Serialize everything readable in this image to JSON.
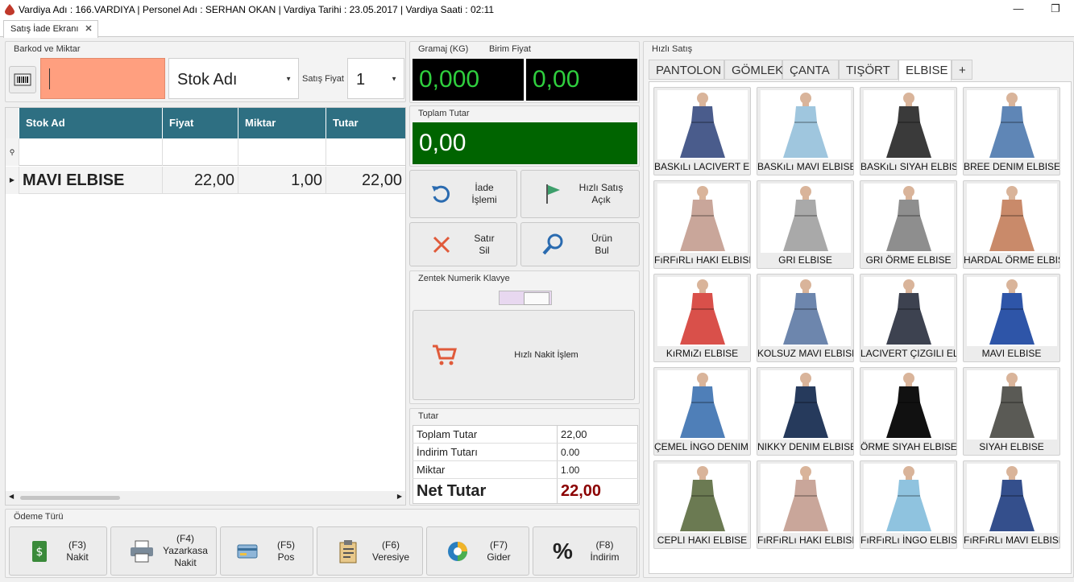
{
  "window": {
    "title": "Vardiya Adı : 166.VARDIYA | Personel Adı : SERHAN OKAN | Vardiya Tarihi : 23.05.2017 | Vardiya Saati : 02:11",
    "minimize": "—",
    "restore": "❐"
  },
  "doc_tab": {
    "label": "Satış İade Ekranı",
    "close": "✕"
  },
  "barcode": {
    "group_label": "Barkod ve Miktar",
    "stock_name_value": "Stok Adı",
    "price_label": "Satış Fiyat",
    "qty_value": "1"
  },
  "grid": {
    "columns": [
      "Stok Ad",
      "Fiyat",
      "Miktar",
      "Tutar"
    ],
    "rows": [
      {
        "name": "MAVI ELBISE",
        "price": "22,00",
        "qty": "1,00",
        "total": "22,00"
      }
    ]
  },
  "scale": {
    "weight_label": "Gramaj (KG)",
    "unit_price_label": "Birim Fiyat",
    "weight_value": "0,000",
    "unit_price_value": "0,00"
  },
  "total": {
    "label": "Toplam Tutar",
    "value": "0,00"
  },
  "actions": {
    "return": {
      "line1": "İade",
      "line2": "İşlemi"
    },
    "quick_sale": {
      "line1": "Hızlı Satış",
      "line2": "Açık"
    },
    "delete_row": {
      "line1": "Satır",
      "line2": "Sil"
    },
    "find_product": {
      "line1": "Ürün",
      "line2": "Bul"
    }
  },
  "keypad": {
    "group_label": "Zentek Numerik Klavye",
    "quick_cash_label": "Hızlı Nakit İşlem"
  },
  "summary": {
    "group_label": "Tutar",
    "rows": [
      {
        "label": "Toplam Tutar",
        "value": "22,00"
      },
      {
        "label": "İndirim Tutarı",
        "value": "0.00"
      },
      {
        "label": "Miktar",
        "value": "1.00"
      }
    ],
    "net_label": "Net Tutar",
    "net_value": "22,00"
  },
  "payment": {
    "group_label": "Ödeme Türü",
    "buttons": [
      {
        "key": "(F3)",
        "label": "Nakit",
        "label2": ""
      },
      {
        "key": "(F4)",
        "label": "Yazarkasa",
        "label2": "Nakit"
      },
      {
        "key": "(F5)",
        "label": "Pos",
        "label2": ""
      },
      {
        "key": "(F6)",
        "label": "Veresiye",
        "label2": ""
      },
      {
        "key": "(F7)",
        "label": "Gider",
        "label2": ""
      },
      {
        "key": "(F8)",
        "label": "İndirim",
        "label2": ""
      }
    ]
  },
  "quick_sale_panel": {
    "group_label": "Hızlı Satış",
    "tabs": [
      "PANTOLON",
      "GÖMLEK",
      "ÇANTA",
      "TIŞÖRT",
      "ELBISE",
      "+"
    ],
    "active_tab": "ELBISE",
    "products": [
      {
        "name": "BASKıLı LACIVERT ELBISE",
        "color": "#4a5c8c"
      },
      {
        "name": "BASKıLı MAVI ELBISE",
        "color": "#9fc6de"
      },
      {
        "name": "BASKıLı SIYAH ELBISE",
        "color": "#3a3a3a"
      },
      {
        "name": "BREE DENIM ELBISE",
        "color": "#5f86b6"
      },
      {
        "name": "FıRFıRLı HAKI ELBISE",
        "color": "#c9a69a"
      },
      {
        "name": "GRI ELBISE",
        "color": "#a9a9a9"
      },
      {
        "name": "GRI ÖRME ELBISE",
        "color": "#8e8e8e"
      },
      {
        "name": "HARDAL ÖRME ELBISE",
        "color": "#c98a6a"
      },
      {
        "name": "KıRMıZı ELBISE",
        "color": "#d9504a"
      },
      {
        "name": "KOLSUZ MAVI ELBISE",
        "color": "#6d86ad"
      },
      {
        "name": "LACIVERT ÇIZGILI ELBISE",
        "color": "#3d4250"
      },
      {
        "name": "MAVI ELBISE",
        "color": "#2e55a8"
      },
      {
        "name": "ÇEMEL İNGO DENIM ELBISE",
        "color": "#4f7fb8"
      },
      {
        "name": "NIKKY DENIM ELBISE",
        "color": "#263a5c"
      },
      {
        "name": "ÖRME SIYAH ELBISE",
        "color": "#111111"
      },
      {
        "name": "SIYAH ELBISE",
        "color": "#5a5a55"
      },
      {
        "name": "CEPLI HAKI ELBISE",
        "color": "#6b7a52"
      },
      {
        "name": "FıRFıRLı HAKI ELBISE",
        "color": "#c9a69a"
      },
      {
        "name": "FıRFıRLı İNGO ELBISE",
        "color": "#8fc3df"
      },
      {
        "name": "FıRFıRLı MAVI ELBISE",
        "color": "#344f8c"
      }
    ]
  },
  "colors": {
    "grid_header": "#2e6f82",
    "barcode_input": "#ff9f7f",
    "lcd_text": "#2fcf3e",
    "total_bg": "#006400",
    "net_value": "#8b0000"
  }
}
